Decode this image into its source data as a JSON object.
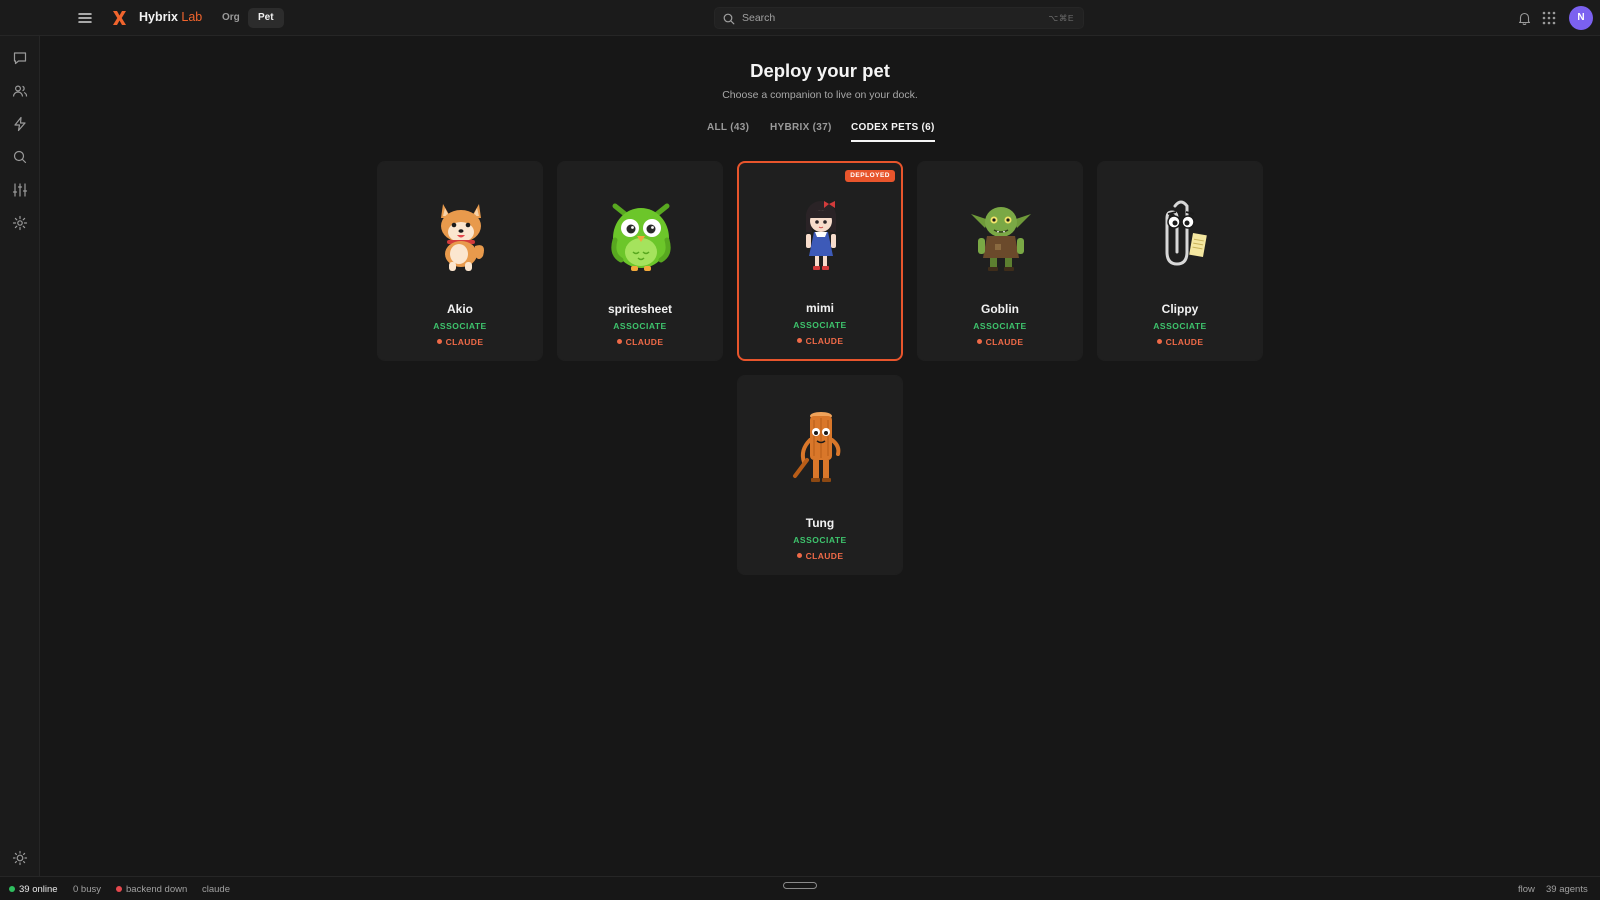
{
  "topbar": {
    "brand_name": "Hybrix",
    "brand_suffix": "Lab",
    "nav": [
      {
        "label": "Org",
        "active": false
      },
      {
        "label": "Pet",
        "active": true
      }
    ],
    "search": {
      "placeholder": "Search",
      "shortcut": "⌥⌘E"
    },
    "avatar_initial": "N",
    "icons": [
      "menu-icon",
      "logo-icon",
      "search-icon",
      "bell-icon",
      "apps-grid-icon"
    ]
  },
  "sidebar": {
    "items": [
      {
        "icon": "chat-icon"
      },
      {
        "icon": "users-icon"
      },
      {
        "icon": "lightning-icon"
      },
      {
        "icon": "search-icon"
      },
      {
        "icon": "sliders-icon"
      },
      {
        "icon": "gear-icon"
      }
    ],
    "bottom_icon": "sun-icon"
  },
  "main": {
    "title": "Deploy your pet",
    "subtitle": "Choose a companion to live on your dock.",
    "tabs": [
      {
        "label": "ALL (43)",
        "active": false
      },
      {
        "label": "HYBRIX (37)",
        "active": false
      },
      {
        "label": "CODEX PETS (6)",
        "active": true
      }
    ],
    "pets": [
      {
        "name": "Akio",
        "role": "ASSOCIATE",
        "model": "CLAUDE",
        "deployed": false,
        "sprite": "shiba-dog-sprite"
      },
      {
        "name": "spritesheet",
        "role": "ASSOCIATE",
        "model": "CLAUDE",
        "deployed": false,
        "sprite": "green-owl-sprite"
      },
      {
        "name": "mimi",
        "role": "ASSOCIATE",
        "model": "CLAUDE",
        "deployed": true,
        "badge": "DEPLOYED",
        "sprite": "girl-sprite"
      },
      {
        "name": "Goblin",
        "role": "ASSOCIATE",
        "model": "CLAUDE",
        "deployed": false,
        "sprite": "goblin-sprite"
      },
      {
        "name": "Clippy",
        "role": "ASSOCIATE",
        "model": "CLAUDE",
        "deployed": false,
        "sprite": "paperclip-sprite"
      },
      {
        "name": "Tung",
        "role": "ASSOCIATE",
        "model": "CLAUDE",
        "deployed": false,
        "sprite": "wooden-log-sprite"
      }
    ]
  },
  "statusbar": {
    "online": "39 online",
    "busy": "0 busy",
    "backend": "backend down",
    "model": "claude",
    "flow": "flow",
    "agents": "39 agents",
    "colors": {
      "online": "#2fbf5f",
      "backend": "#e5484d"
    }
  },
  "colors": {
    "accent": "#e8552c",
    "role": "#3ec46d",
    "model": "#ef6a48",
    "background": "#171717",
    "card": "#1f1f1f"
  }
}
